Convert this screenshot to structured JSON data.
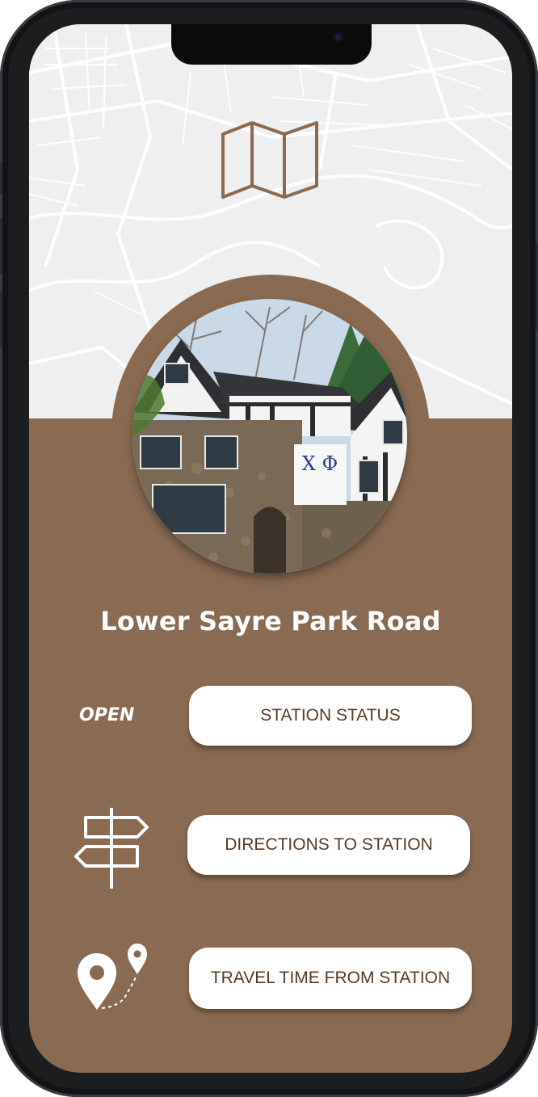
{
  "station": {
    "name": "Lower Sayre Park Road",
    "status": "OPEN"
  },
  "buttons": {
    "status": "STATION STATUS",
    "directions": "DIRECTIONS TO STATION",
    "travel_time": "TRAVEL TIME FROM STATION"
  },
  "photo": {
    "banner_text": "Χ Φ"
  },
  "icons": {
    "header": "map-icon",
    "directions": "signpost-icon",
    "travel": "route-pin-icon"
  },
  "colors": {
    "brand_brown": "#8a6a50",
    "button_text": "#5a3a22",
    "map_background": "#efefef"
  }
}
